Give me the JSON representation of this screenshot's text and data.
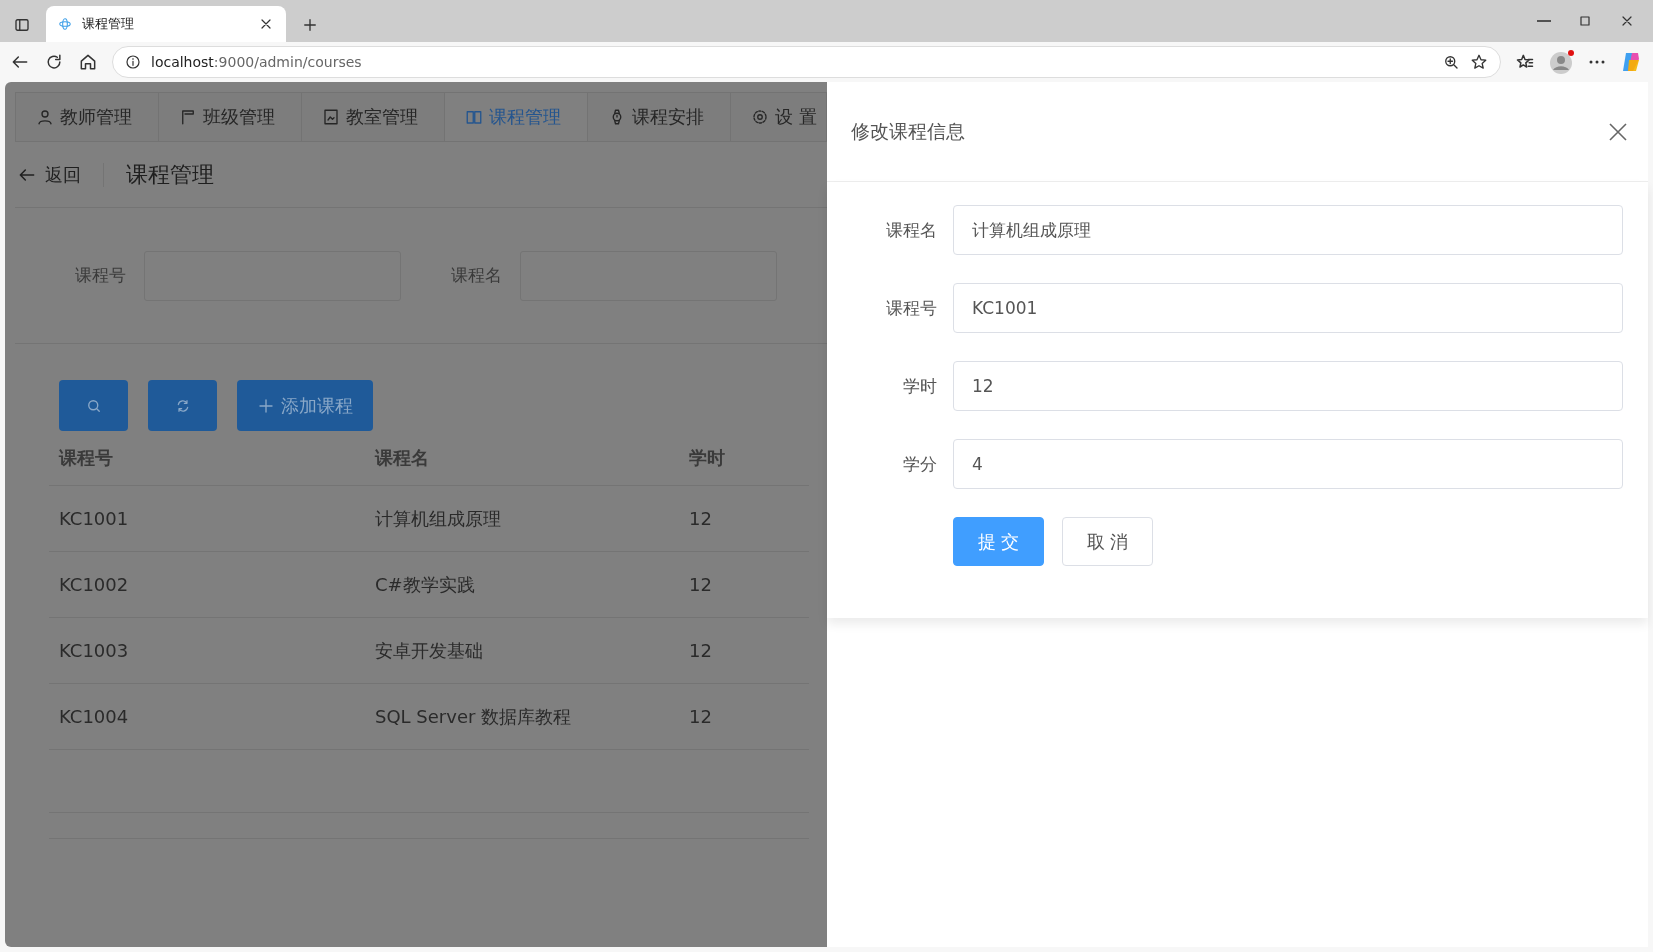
{
  "browser": {
    "tab_title": "课程管理",
    "url_host": "localhost",
    "url_rest": ":9000/admin/courses"
  },
  "nav_tabs": [
    {
      "label": "教师管理",
      "kind": "user",
      "selected": false
    },
    {
      "label": "班级管理",
      "kind": "flag",
      "selected": false
    },
    {
      "label": "教室管理",
      "kind": "room",
      "selected": false
    },
    {
      "label": "课程管理",
      "kind": "book",
      "selected": true
    },
    {
      "label": "课程安排",
      "kind": "watch",
      "selected": false
    },
    {
      "label": "设 置",
      "kind": "gear",
      "selected": false
    }
  ],
  "header": {
    "back_label": "返回",
    "title": "课程管理"
  },
  "filters": [
    {
      "label": "课程号"
    },
    {
      "label": "课程名"
    }
  ],
  "toolbar": [
    {
      "kind": "search"
    },
    {
      "kind": "refresh"
    },
    {
      "kind": "add",
      "label": "添加课程"
    }
  ],
  "table": {
    "columns": [
      "课程号",
      "课程名",
      "学时"
    ],
    "rows": [
      [
        "KC1001",
        "计算机组成原理",
        "12"
      ],
      [
        "KC1002",
        "C#教学实践",
        "12"
      ],
      [
        "KC1003",
        "安卓开发基础",
        "12"
      ],
      [
        "KC1004",
        "SQL Server 数据库教程",
        "12"
      ]
    ]
  },
  "drawer": {
    "title": "修改课程信息",
    "fields": [
      {
        "label": "课程名",
        "value": "计算机组成原理"
      },
      {
        "label": "课程号",
        "value": "KC1001"
      },
      {
        "label": "学时",
        "value": "12"
      },
      {
        "label": "学分",
        "value": "4"
      }
    ],
    "buttons": [
      {
        "label": "提 交",
        "kind": "primary"
      },
      {
        "label": "取 消",
        "kind": "default"
      }
    ]
  }
}
